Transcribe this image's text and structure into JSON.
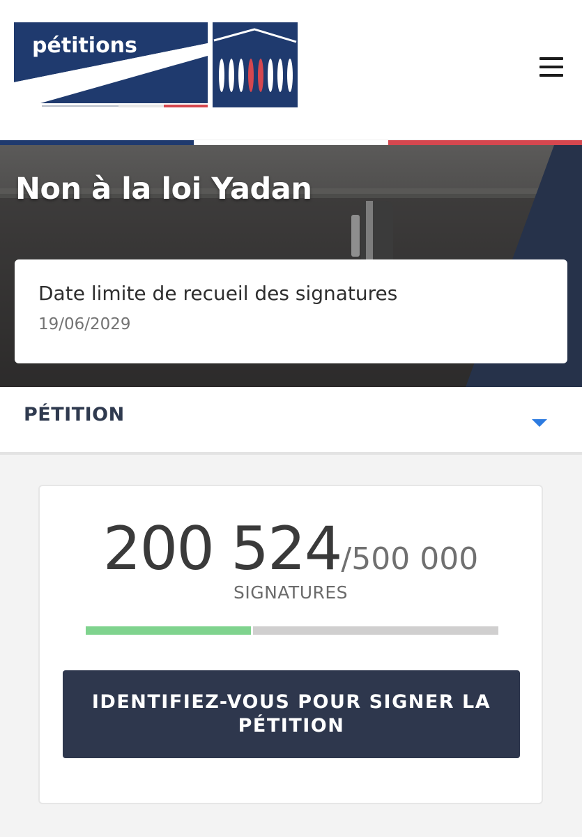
{
  "header": {
    "logo_text": "pétitions",
    "menu_icon": "hamburger-menu-icon"
  },
  "hero": {
    "title": "Non à la loi Yadan",
    "deadline_label": "Date limite de recueil des signatures",
    "deadline_date": "19/06/2029"
  },
  "section": {
    "label": "PÉTITION",
    "toggle_icon": "caret-down-icon"
  },
  "signatures": {
    "count": "200 524",
    "goal": "/500 000",
    "label": "SIGNATURES",
    "progress_fraction": 0.401
  },
  "sign_button": {
    "label": "IDENTIFIEZ-VOUS POUR SIGNER LA PÉTITION"
  },
  "colors": {
    "navy": "#1f3a6e",
    "button_bg": "#2e374d",
    "progress_fill": "#7fd38e",
    "progress_track": "#d0cfcf",
    "flag_red": "#d5474f",
    "caret_blue": "#2d7be0"
  }
}
